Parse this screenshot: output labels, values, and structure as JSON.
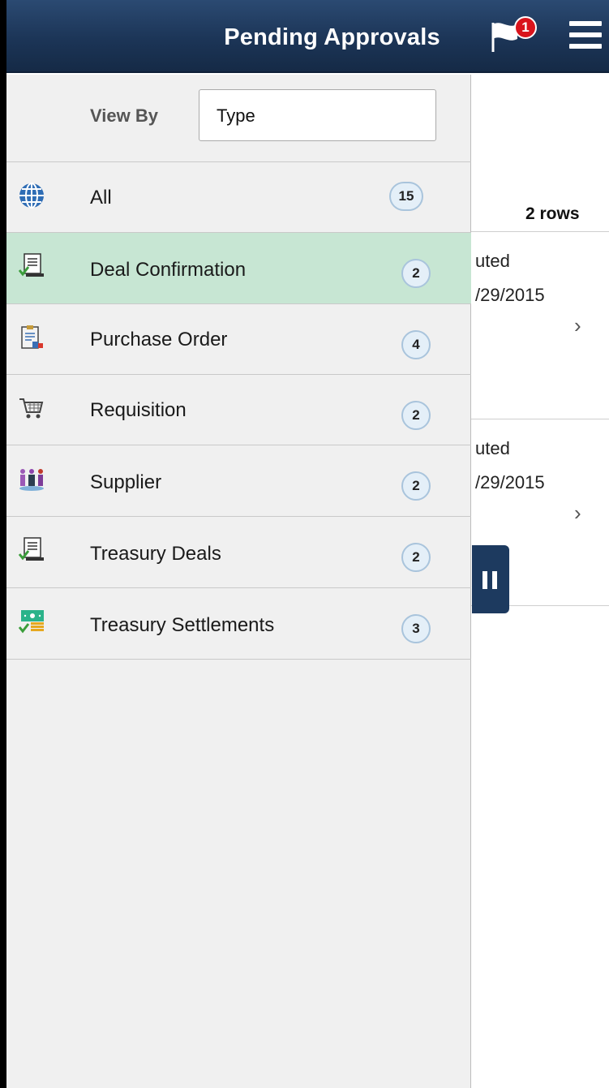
{
  "header": {
    "title": "Pending Approvals",
    "notification_count": "1"
  },
  "viewby": {
    "label": "View By",
    "value": "Type"
  },
  "items": [
    {
      "label": "All",
      "count": "15",
      "icon": "globe-icon"
    },
    {
      "label": "Deal Confirmation",
      "count": "2",
      "icon": "deal-confirmation-icon",
      "selected": true
    },
    {
      "label": "Purchase Order",
      "count": "4",
      "icon": "purchase-order-icon"
    },
    {
      "label": "Requisition",
      "count": "2",
      "icon": "shopping-cart-icon"
    },
    {
      "label": "Supplier",
      "count": "2",
      "icon": "supplier-people-icon"
    },
    {
      "label": "Treasury Deals",
      "count": "2",
      "icon": "treasury-deals-icon"
    },
    {
      "label": "Treasury Settlements",
      "count": "3",
      "icon": "treasury-settlements-icon"
    }
  ],
  "background": {
    "rows_count": "2 rows",
    "rows": [
      {
        "line1": "uted",
        "line2": "/29/2015"
      },
      {
        "line1": "uted",
        "line2": "/29/2015"
      }
    ]
  },
  "colors": {
    "header": "#1c3557",
    "selected": "#c7e6d3",
    "panel": "#f0f0f0",
    "badge": "#d9141c"
  }
}
